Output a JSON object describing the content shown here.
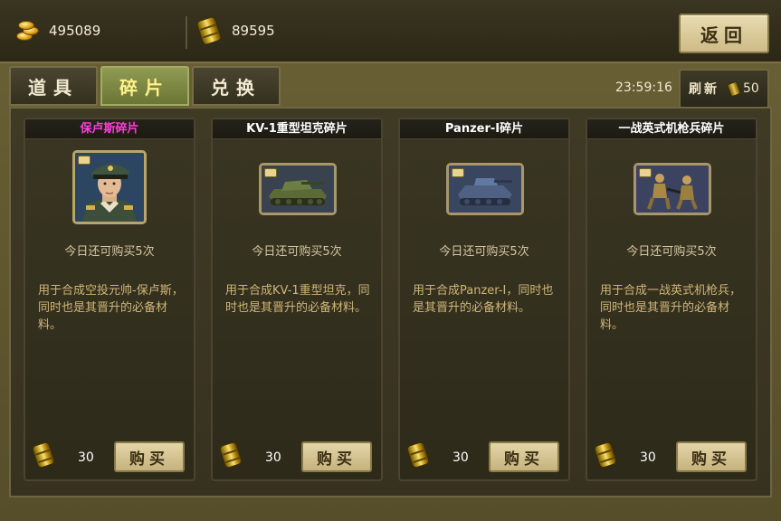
{
  "header": {
    "gold_amount": "495089",
    "fuel_amount": "89595",
    "back_label": "返回",
    "gold_icon": "gold-coins-icon",
    "fuel_icon": "fuel-barrel-icon"
  },
  "tabs": [
    {
      "label": "道具",
      "active": false
    },
    {
      "label": "碎片",
      "active": true
    },
    {
      "label": "兑换",
      "active": false
    }
  ],
  "timer": "23:59:16",
  "refresh": {
    "label": "刷新",
    "cost": "50"
  },
  "cards": [
    {
      "title": "保卢斯碎片",
      "title_color": "#ff3ddc",
      "image": "general-portrait-icon",
      "quota": "今日还可购买5次",
      "description": "用于合成空投元帅-保卢斯，同时也是其晋升的必备材料。",
      "price": "30",
      "buy_label": "购买"
    },
    {
      "title": "KV-1重型坦克碎片",
      "title_color": "#ffffff",
      "image": "heavy-tank-icon",
      "quota": "今日还可购买5次",
      "description": "用于合成KV-1重型坦克，同时也是其晋升的必备材料。",
      "price": "30",
      "buy_label": "购买"
    },
    {
      "title": "Panzer-I碎片",
      "title_color": "#ffffff",
      "image": "light-tank-icon",
      "quota": "今日还可购买5次",
      "description": "用于合成Panzer-I，同时也是其晋升的必备材料。",
      "price": "30",
      "buy_label": "购买"
    },
    {
      "title": "一战英式机枪兵碎片",
      "title_color": "#ffffff",
      "image": "machine-gunner-icon",
      "quota": "今日还可购买5次",
      "description": "用于合成一战英式机枪兵，同时也是其晋升的必备材料。",
      "price": "30",
      "buy_label": "购买"
    }
  ]
}
